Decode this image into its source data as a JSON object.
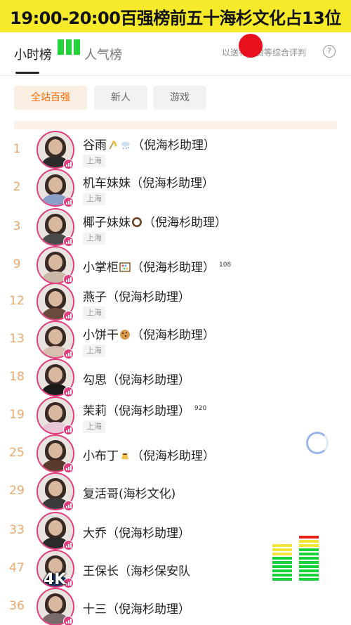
{
  "banner": {
    "text": "19:00-20:00百强榜前五十海杉文化占13位"
  },
  "tabs": {
    "hourly": "小时榜",
    "popularity": "人气榜",
    "rule_hint": "以送礼点赞等综合评判",
    "info_icon": "info-circle-icon"
  },
  "filters": [
    {
      "label": "全站百强",
      "selected": true
    },
    {
      "label": "新人",
      "selected": false
    },
    {
      "label": "游戏",
      "selected": false
    }
  ],
  "rows": [
    {
      "rank": "1",
      "name": "谷雨",
      "suffix": "（倪海杉助理）",
      "emoji": [
        "rice-icon",
        "cloud-snow-icon"
      ],
      "location": "上海",
      "count": ""
    },
    {
      "rank": "2",
      "name": "机车妹妹",
      "suffix": "（倪海杉助理）",
      "emoji": [],
      "location": "上海",
      "count": ""
    },
    {
      "rank": "3",
      "name": "椰子妹妹",
      "suffix": "（倪海杉助理）",
      "emoji": [
        "coconut-icon"
      ],
      "location": "上海",
      "count": ""
    },
    {
      "rank": "9",
      "name": "小掌柜",
      "suffix": "（倪海杉助理）",
      "emoji": [
        "abacus-icon"
      ],
      "location": "",
      "count": "108"
    },
    {
      "rank": "12",
      "name": "燕子",
      "suffix": "（倪海杉助理）",
      "emoji": [],
      "location": "上海",
      "count": ""
    },
    {
      "rank": "13",
      "name": "小饼干",
      "suffix": "（倪海杉助理）",
      "emoji": [
        "cookie-icon"
      ],
      "location": "上海",
      "count": ""
    },
    {
      "rank": "18",
      "name": "勾思",
      "suffix": "（倪海杉助理）",
      "emoji": [],
      "location": "",
      "count": ""
    },
    {
      "rank": "19",
      "name": "茉莉",
      "suffix": "（倪海杉助理）",
      "emoji": [],
      "location": "上海",
      "count": "920"
    },
    {
      "rank": "25",
      "name": "小布丁",
      "suffix": "（倪海杉助理）",
      "emoji": [
        "pudding-icon"
      ],
      "location": "",
      "count": ""
    },
    {
      "rank": "29",
      "name": "复活哥",
      "suffix": "(海杉文化)",
      "emoji": [],
      "location": "",
      "count": ""
    },
    {
      "rank": "33",
      "name": "大乔",
      "suffix": "（倪海杉助理）",
      "emoji": [],
      "location": "",
      "count": ""
    },
    {
      "rank": "47",
      "name": "王保长",
      "suffix": "（海杉保安队",
      "emoji": [],
      "location": "",
      "count": ""
    },
    {
      "rank": "36",
      "name": "十三",
      "suffix": "（倪海杉助理）",
      "emoji": [],
      "location": "",
      "count": ""
    }
  ],
  "overlay": {
    "watermark": "4K"
  },
  "colors": {
    "banner": "#f6ea2a",
    "accent": "#ff6a00",
    "rank": "#e8a86c",
    "avatar_ring": "#e0407f"
  }
}
